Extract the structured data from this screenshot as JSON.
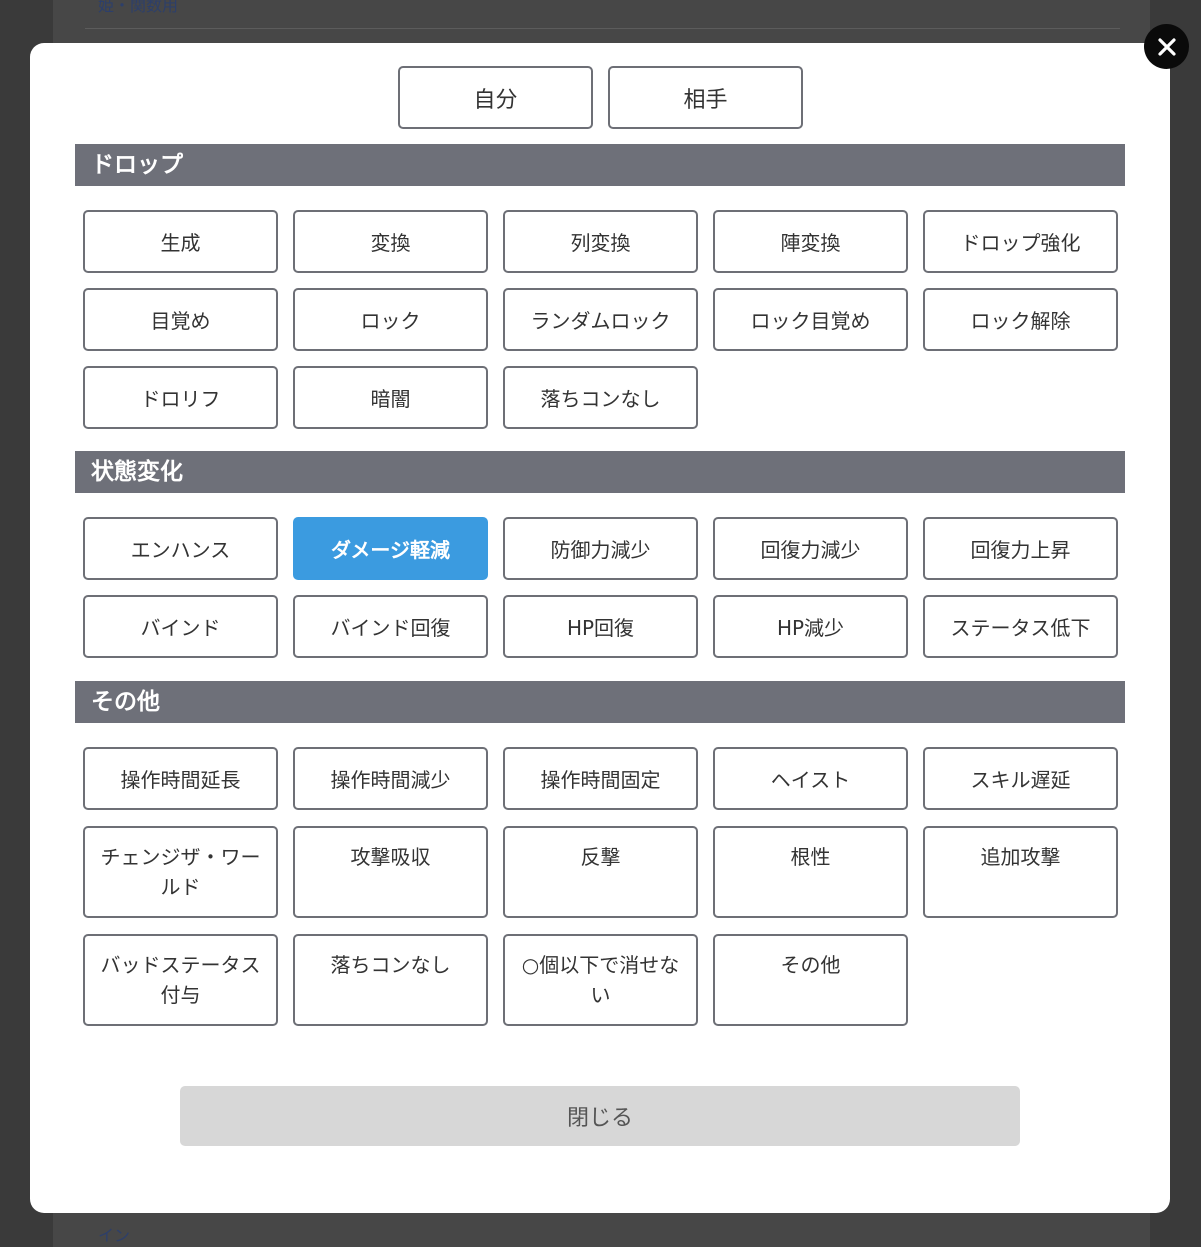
{
  "background": {
    "top_text": "姫・関数用",
    "bottom_text": "イン"
  },
  "target_tabs": [
    {
      "label": "自分"
    },
    {
      "label": "相手"
    }
  ],
  "sections": [
    {
      "title": "ドロップ",
      "items": [
        {
          "label": "生成"
        },
        {
          "label": "変換"
        },
        {
          "label": "列変換"
        },
        {
          "label": "陣変換"
        },
        {
          "label": "ドロップ強化"
        },
        {
          "label": "目覚め"
        },
        {
          "label": "ロック"
        },
        {
          "label": "ランダムロック"
        },
        {
          "label": "ロック目覚め"
        },
        {
          "label": "ロック解除"
        },
        {
          "label": "ドロリフ"
        },
        {
          "label": "暗闇"
        },
        {
          "label": "落ちコンなし"
        }
      ]
    },
    {
      "title": "状態変化",
      "items": [
        {
          "label": "エンハンス"
        },
        {
          "label": "ダメージ軽減",
          "selected": true
        },
        {
          "label": "防御力減少"
        },
        {
          "label": "回復力減少"
        },
        {
          "label": "回復力上昇"
        },
        {
          "label": "バインド"
        },
        {
          "label": "バインド回復"
        },
        {
          "label": "HP回復"
        },
        {
          "label": "HP減少"
        },
        {
          "label": "ステータス低下"
        }
      ]
    },
    {
      "title": "その他",
      "items": [
        {
          "label": "操作時間延長"
        },
        {
          "label": "操作時間減少"
        },
        {
          "label": "操作時間固定"
        },
        {
          "label": "ヘイスト"
        },
        {
          "label": "スキル遅延"
        },
        {
          "label": "チェンジザ・ワールド"
        },
        {
          "label": "攻撃吸収"
        },
        {
          "label": "反撃"
        },
        {
          "label": "根性"
        },
        {
          "label": "追加攻撃"
        },
        {
          "label": "バッドステータス付与"
        },
        {
          "label": "落ちコンなし"
        },
        {
          "label": "○個以下で消せない"
        },
        {
          "label": "その他"
        }
      ]
    }
  ],
  "close_button_label": "閉じる",
  "icons": {
    "close": "close-icon"
  },
  "colors": {
    "section_header_bg": "#6e7079",
    "selected_bg": "#3b9be0",
    "button_border": "#6d6f76",
    "close_bottom_bg": "#d7d7d7"
  }
}
